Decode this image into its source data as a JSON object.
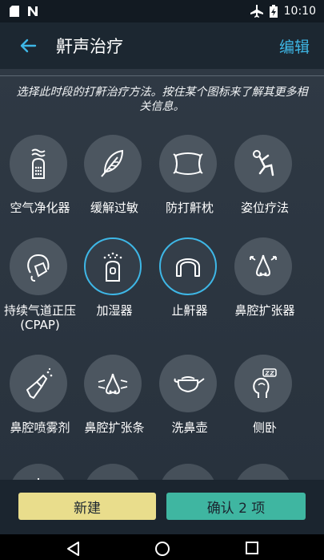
{
  "status_bar": {
    "time": "10:10",
    "icons": [
      "sd-card-icon",
      "notification-n-icon",
      "airplane-icon",
      "battery-charging-icon"
    ]
  },
  "app_bar": {
    "title": "鼾声治疗",
    "edit_label": "编辑"
  },
  "instructions": "选择此时段的打鼾治疗方法。按住某个图标来了解其更多相关信息。",
  "remedies": [
    {
      "label": "空气净化器",
      "icon": "air-purifier-icon",
      "selected": false
    },
    {
      "label": "缓解过敏",
      "icon": "feather-icon",
      "selected": false
    },
    {
      "label": "防打鼾枕",
      "icon": "pillow-icon",
      "selected": false
    },
    {
      "label": "姿位疗法",
      "icon": "posture-icon",
      "selected": false
    },
    {
      "label": "持续气道正压(CPAP)",
      "icon": "cpap-mask-icon",
      "selected": false
    },
    {
      "label": "加湿器",
      "icon": "humidifier-icon",
      "selected": true
    },
    {
      "label": "止鼾器",
      "icon": "mouthguard-icon",
      "selected": true
    },
    {
      "label": "鼻腔扩张器",
      "icon": "nasal-dilator-icon",
      "selected": false
    },
    {
      "label": "鼻腔喷雾剂",
      "icon": "nasal-spray-icon",
      "selected": false
    },
    {
      "label": "鼻腔扩张条",
      "icon": "nasal-strip-icon",
      "selected": false
    },
    {
      "label": "洗鼻壶",
      "icon": "neti-pot-icon",
      "selected": false
    },
    {
      "label": "侧卧",
      "icon": "side-sleep-icon",
      "selected": false
    }
  ],
  "buttons": {
    "new_label": "新建",
    "confirm_label": "确认 2 项"
  },
  "colors": {
    "accent": "#3eb7e6",
    "new_button": "#e9dd8c",
    "confirm_button": "#3fb6a1",
    "icon_circle": "#4c5660"
  }
}
